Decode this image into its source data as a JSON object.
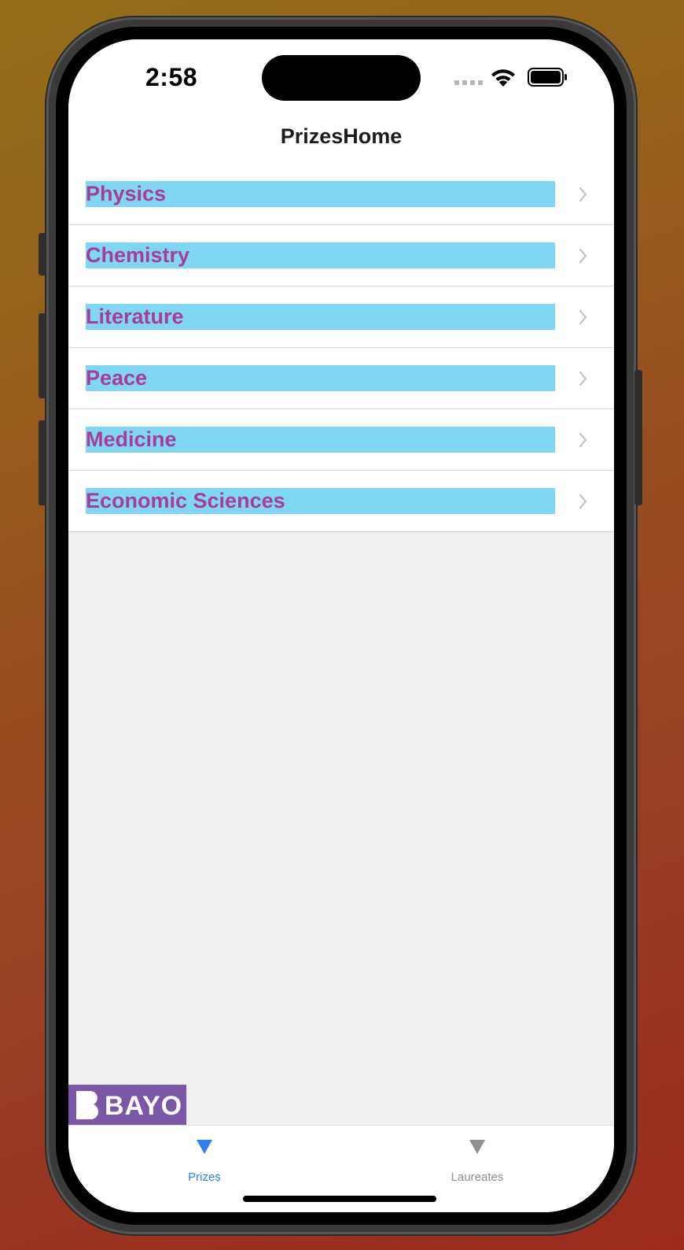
{
  "status_bar": {
    "time": "2:58"
  },
  "nav": {
    "title": "PrizesHome"
  },
  "prize_list": {
    "items": [
      {
        "label": "Physics"
      },
      {
        "label": "Chemistry"
      },
      {
        "label": "Literature"
      },
      {
        "label": "Peace"
      },
      {
        "label": "Medicine"
      },
      {
        "label": "Economic Sciences"
      }
    ],
    "label_color": "#a93c96",
    "label_highlight_color": "#80d6f5",
    "chevron_icon": "chevron-right-icon"
  },
  "watermark": {
    "text": "BAYO"
  },
  "tab_bar": {
    "tabs": [
      {
        "label": "Prizes",
        "icon": "triangle-down-icon",
        "selected": true,
        "color": "#2f7ff0"
      },
      {
        "label": "Laureates",
        "icon": "triangle-down-icon",
        "selected": false,
        "color": "#8e8e93"
      }
    ]
  }
}
